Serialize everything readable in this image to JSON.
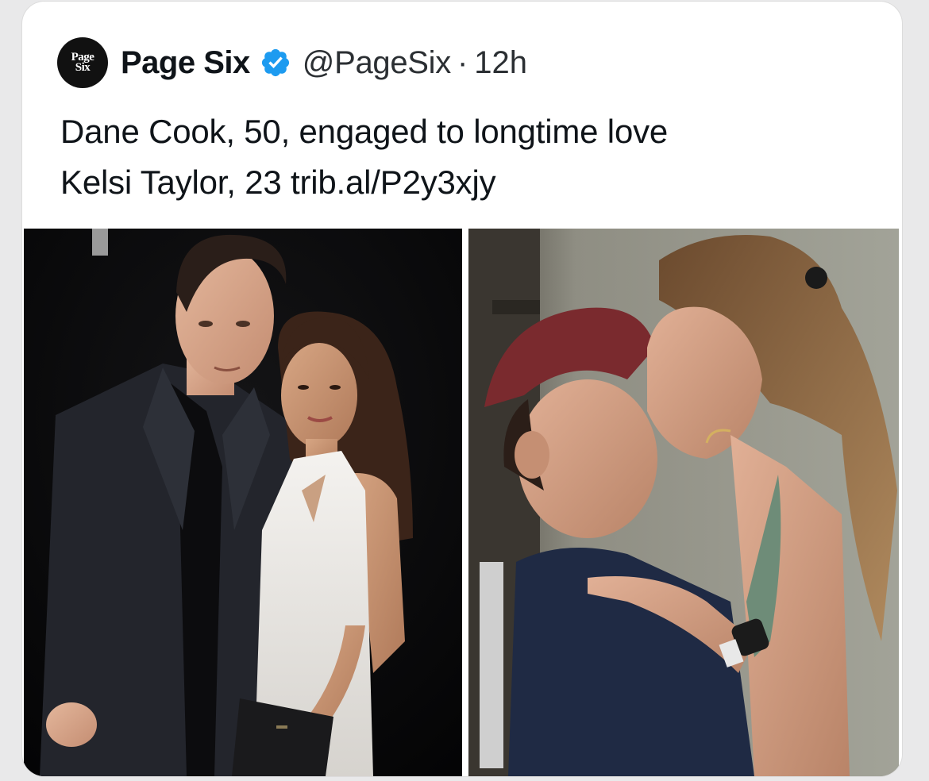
{
  "tweet": {
    "avatar": {
      "line1": "Page",
      "line2": "Six"
    },
    "display_name": "Page Six",
    "verified_icon": "verified-badge-icon",
    "handle": "@PageSix",
    "separator": "·",
    "timestamp": "12h",
    "text_line1": "Dane Cook, 50, engaged to longtime love",
    "text_line2": "Kelsi Taylor, 23 trib.al/P2y3xjy"
  },
  "media": {
    "left_photo": "couple-posing-photo",
    "right_photo": "couple-kissing-photo"
  },
  "colors": {
    "verified_blue": "#1d9bf0",
    "text": "#0f1419",
    "secondary_text": "#2b2f33"
  }
}
